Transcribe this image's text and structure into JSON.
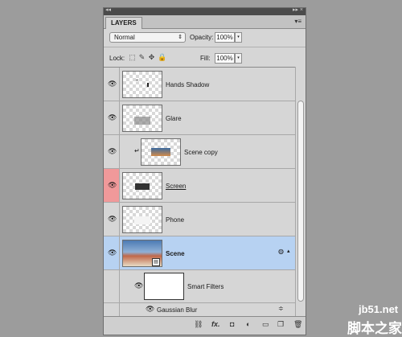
{
  "panel": {
    "tab_label": "LAYERS",
    "menu_icon": "panel-menu-icon",
    "title_collapse": "◂◂",
    "title_close": "▸▸ ×"
  },
  "blend": {
    "mode": "Normal",
    "arrow": "⇕"
  },
  "opacity": {
    "label": "Opacity:",
    "value": "100%",
    "arrow": "▾"
  },
  "lock": {
    "label": "Lock:",
    "icons": [
      "lock-transparent-icon",
      "lock-image-icon",
      "lock-position-icon",
      "lock-all-icon"
    ]
  },
  "fill": {
    "label": "Fill:",
    "value": "100%",
    "arrow": "▾"
  },
  "layers": [
    {
      "name": "Hands Shadow",
      "visible": true,
      "selected": false,
      "clipped": false
    },
    {
      "name": "Glare",
      "visible": true,
      "selected": false,
      "clipped": false
    },
    {
      "name": "Scene copy",
      "visible": true,
      "selected": false,
      "clipped": true
    },
    {
      "name": "Screen",
      "visible": true,
      "selected": false,
      "clipped": false,
      "eye_highlight": "#f0999a"
    },
    {
      "name": "Phone",
      "visible": true,
      "selected": false,
      "clipped": false
    },
    {
      "name": "Scene",
      "visible": true,
      "selected": true,
      "clipped": false,
      "smart_object": true
    }
  ],
  "smart_filters": {
    "label": "Smart Filters",
    "visible": true
  },
  "filters": [
    {
      "name": "Gaussian Blur",
      "visible": true
    }
  ],
  "bottom_buttons": [
    "link-layers-icon",
    "fx-icon",
    "add-mask-icon",
    "adjustment-layer-icon",
    "new-group-icon",
    "new-layer-icon",
    "delete-layer-icon"
  ],
  "fx_text": "fx.",
  "watermark": {
    "line1": "jb51.net",
    "line2": "脚本之家"
  },
  "colors": {
    "selected_row": "#b7d2f2",
    "eye_highlight": "#f0999a",
    "panel_bg": "#d6d6d6"
  }
}
